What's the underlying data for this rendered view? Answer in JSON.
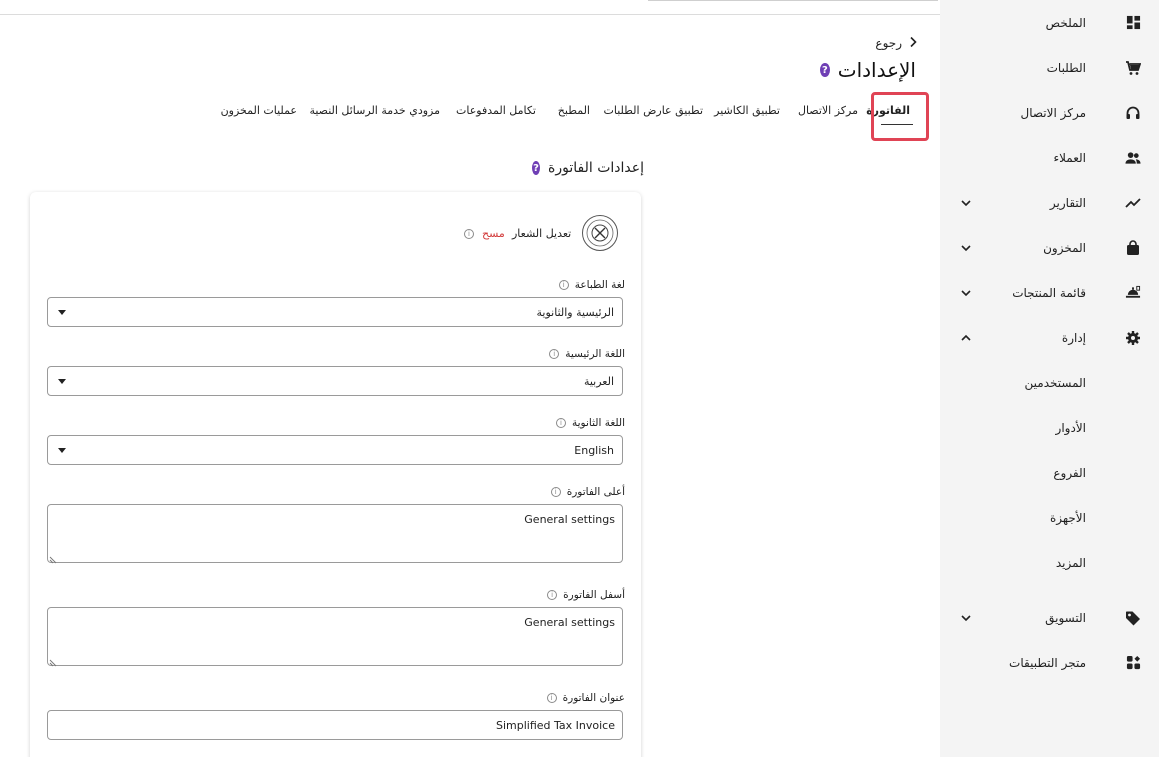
{
  "colors": {
    "accent": "#6f3fb5",
    "danger": "#d23a3a",
    "highlight": "#e04455",
    "sidebar_bg": "#f4f4f4"
  },
  "sidebar": {
    "items": [
      {
        "label": "الملخص",
        "icon": "dashboard-icon"
      },
      {
        "label": "الطلبات",
        "icon": "cart-icon"
      },
      {
        "label": "مركز الاتصال",
        "icon": "headset-icon"
      },
      {
        "label": "العملاء",
        "icon": "users-icon"
      },
      {
        "label": "التقارير",
        "icon": "chart-line-icon"
      },
      {
        "label": "المخزون",
        "icon": "bag-icon"
      },
      {
        "label": "قائمة المنتجات",
        "icon": "food-menu-icon"
      },
      {
        "label": "إدارة",
        "icon": "gear-icon"
      },
      {
        "label": "التسويق",
        "icon": "tag-icon"
      },
      {
        "label": "متجر التطبيقات",
        "icon": "apps-icon"
      }
    ],
    "manage_sub": [
      "المستخدمين",
      "الأدوار",
      "الفروع",
      "الأجهزة",
      "المزيد"
    ]
  },
  "header": {
    "back_label": "رجوع",
    "title": "الإعدادات",
    "help_glyph": "?"
  },
  "tabs": [
    {
      "label": "الفاتورة",
      "active": true
    },
    {
      "label": "مركز الاتصال",
      "active": false
    },
    {
      "label": "تطبيق الكاشير",
      "active": false
    },
    {
      "label": "تطبيق عارض الطلبات",
      "active": false
    },
    {
      "label": "المطبخ",
      "active": false
    },
    {
      "label": "تكامل المدفوعات",
      "active": false
    },
    {
      "label": "مزودي خدمة الرسائل النصية",
      "active": false
    },
    {
      "label": "عمليات المخزون",
      "active": false
    }
  ],
  "section": {
    "title": "إعدادات الفاتورة",
    "logo_edit_label": "تعديل الشعار",
    "logo_delete_label": "مسح",
    "info_glyph": "i"
  },
  "fields": {
    "print_language": {
      "label": "لغة الطباعة",
      "value": "الرئيسية والثانوية"
    },
    "primary_language": {
      "label": "اللغة الرئيسية",
      "value": "العربية"
    },
    "secondary_language": {
      "label": "اللغة الثانوية",
      "value": "English"
    },
    "invoice_header": {
      "label": "أعلى الفاتورة",
      "value": "General settings"
    },
    "invoice_footer": {
      "label": "أسفل الفاتورة",
      "value": "General settings"
    },
    "invoice_title": {
      "label": "عنوان الفاتورة",
      "value": "Simplified Tax Invoice"
    }
  }
}
